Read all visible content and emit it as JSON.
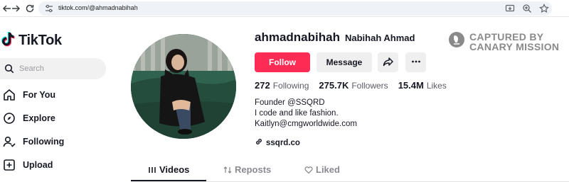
{
  "browser": {
    "url": "tiktok.com/@ahmadnabihah",
    "back_icon": "arrow-left-icon",
    "forward_icon": "arrow-right-icon",
    "reload_icon": "reload-icon"
  },
  "sidebar": {
    "logo_text": "TikTok",
    "search_placeholder": "Search",
    "items": [
      {
        "label": "For You",
        "icon": "home-icon"
      },
      {
        "label": "Explore",
        "icon": "compass-icon"
      },
      {
        "label": "Following",
        "icon": "user-following-icon"
      },
      {
        "label": "Upload",
        "icon": "upload-plus-icon"
      }
    ]
  },
  "profile": {
    "username": "ahmadnabihah",
    "display_name": "Nabihah Ahmad",
    "follow_label": "Follow",
    "message_label": "Message",
    "stats": {
      "following_count": "272",
      "following_label": "Following",
      "followers_count": "275.7K",
      "followers_label": "Followers",
      "likes_count": "15.4M",
      "likes_label": "Likes"
    },
    "bio": [
      "Founder @SSQRD",
      "I code and like fashion.",
      "Kaitlyn@cmgworldwide.com"
    ],
    "link": "ssqrd.co"
  },
  "watermark": {
    "line1": "CAPTURED BY",
    "line2": "CANARY MISSION"
  },
  "tabs": [
    {
      "label": "Videos",
      "active": true
    },
    {
      "label": "Reposts",
      "active": false
    },
    {
      "label": "Liked",
      "active": false
    }
  ],
  "colors": {
    "accent": "#fe2c55",
    "text": "#161823",
    "muted": "#8a8b91"
  }
}
